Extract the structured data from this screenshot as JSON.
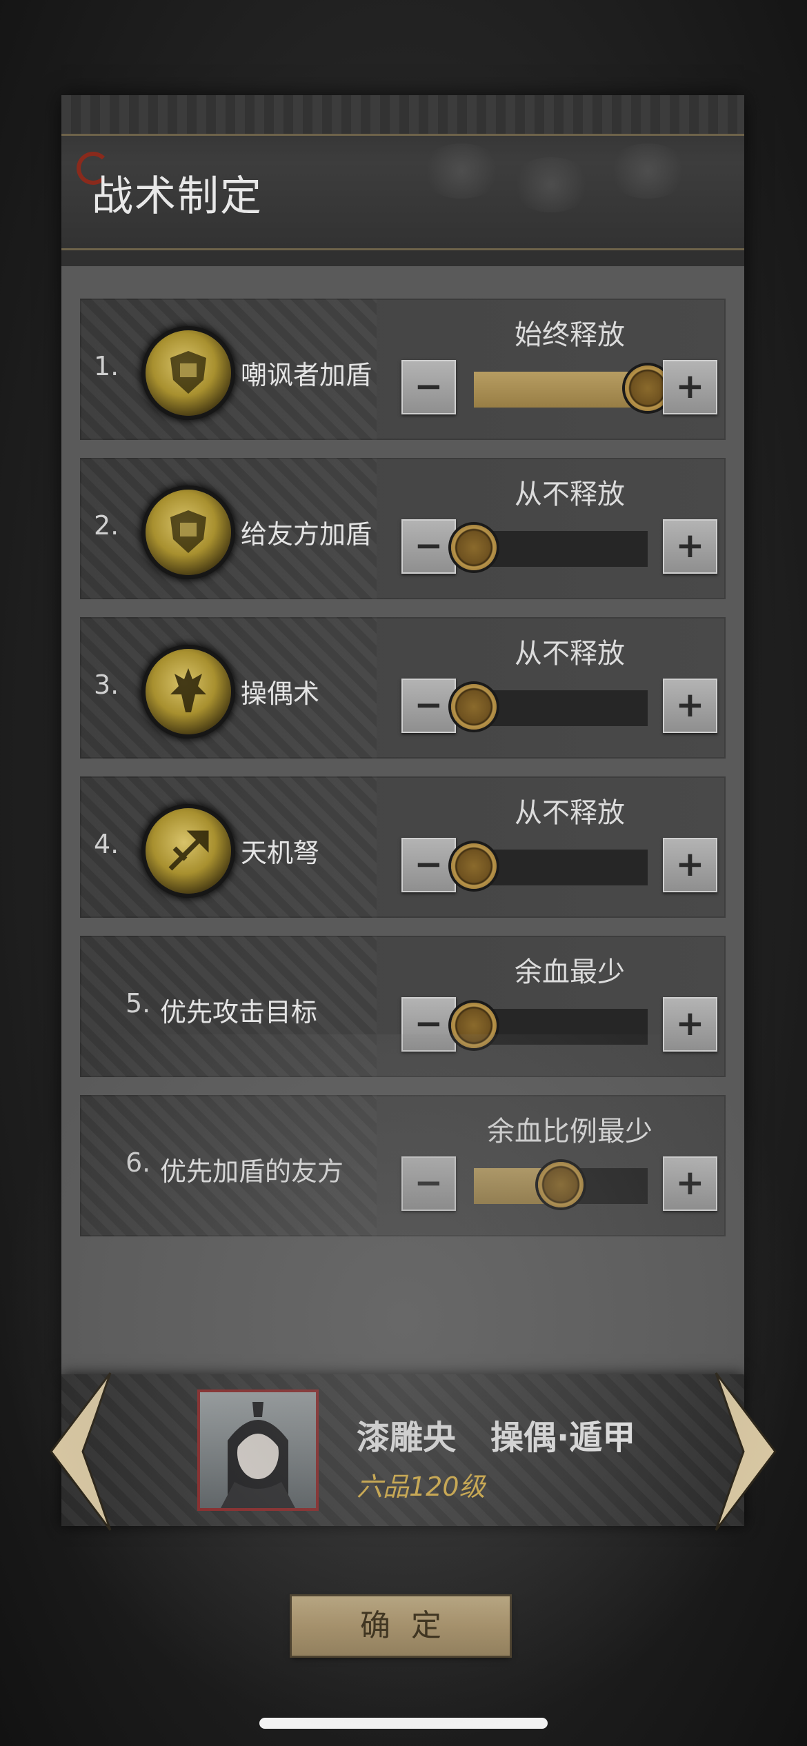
{
  "header": {
    "title": "战术制定"
  },
  "tactics": [
    {
      "number": "1.",
      "label": "嘲讽者加盾",
      "option": "始终释放",
      "level": 1.0,
      "icon": "shield-skill-icon"
    },
    {
      "number": "2.",
      "label": "给友方加盾",
      "option": "从不释放",
      "level": 0.0,
      "icon": "shield-skill-icon"
    },
    {
      "number": "3.",
      "label": "操偶术",
      "option": "从不释放",
      "level": 0.0,
      "icon": "puppet-skill-icon"
    },
    {
      "number": "4.",
      "label": "天机弩",
      "option": "从不释放",
      "level": 0.0,
      "icon": "crossbow-skill-icon"
    },
    {
      "number": "5.",
      "label": "优先攻击目标",
      "option": "余血最少",
      "level": 0.0
    },
    {
      "number": "6.",
      "label": "优先加盾的友方",
      "option": "余血比例最少",
      "level": 0.5
    }
  ],
  "controls": {
    "minus": "−",
    "plus": "+"
  },
  "character": {
    "name": "漆雕央",
    "class": "操偶·遁甲",
    "rank": "六品120级"
  },
  "confirm_label": "确定",
  "colors": {
    "accent_gold": "#b79d62",
    "rank_gold": "#d9b24a",
    "portrait_border": "#8a2828"
  }
}
